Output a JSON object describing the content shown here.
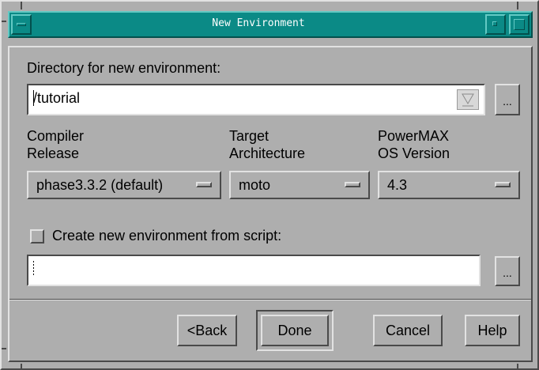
{
  "window": {
    "title": "New Environment"
  },
  "directory": {
    "label": "Directory for new environment:",
    "value": "/tutorial",
    "browse_label": "..."
  },
  "options": [
    {
      "label_line1": "Compiler",
      "label_line2": "Release",
      "selected": "phase3.3.2 (default)"
    },
    {
      "label_line1": "Target",
      "label_line2": "Architecture",
      "selected": "moto"
    },
    {
      "label_line1": "PowerMAX",
      "label_line2": "OS Version",
      "selected": "4.3"
    }
  ],
  "script": {
    "checkbox_label": "Create new environment from script:",
    "checked": false,
    "value": "",
    "browse_label": "..."
  },
  "buttons": {
    "back": "<Back",
    "done": "Done",
    "cancel": "Cancel",
    "help": "Help"
  }
}
